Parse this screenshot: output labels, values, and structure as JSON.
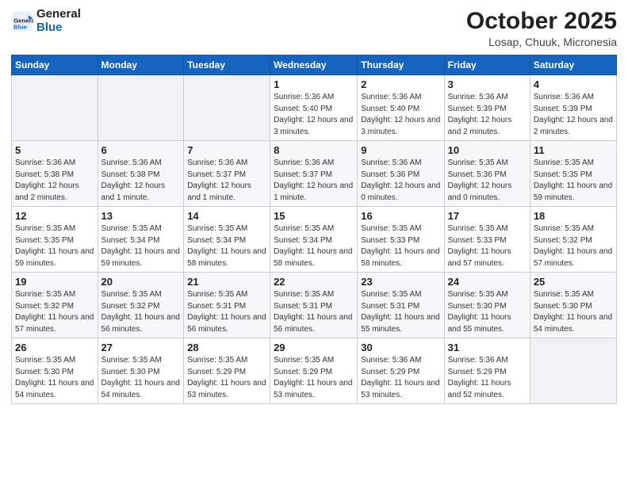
{
  "header": {
    "logo_line1": "General",
    "logo_line2": "Blue",
    "month": "October 2025",
    "location": "Losap, Chuuk, Micronesia"
  },
  "weekdays": [
    "Sunday",
    "Monday",
    "Tuesday",
    "Wednesday",
    "Thursday",
    "Friday",
    "Saturday"
  ],
  "weeks": [
    [
      {
        "day": "",
        "info": ""
      },
      {
        "day": "",
        "info": ""
      },
      {
        "day": "",
        "info": ""
      },
      {
        "day": "1",
        "info": "Sunrise: 5:36 AM\nSunset: 5:40 PM\nDaylight: 12 hours\nand 3 minutes."
      },
      {
        "day": "2",
        "info": "Sunrise: 5:36 AM\nSunset: 5:40 PM\nDaylight: 12 hours\nand 3 minutes."
      },
      {
        "day": "3",
        "info": "Sunrise: 5:36 AM\nSunset: 5:39 PM\nDaylight: 12 hours\nand 2 minutes."
      },
      {
        "day": "4",
        "info": "Sunrise: 5:36 AM\nSunset: 5:39 PM\nDaylight: 12 hours\nand 2 minutes."
      }
    ],
    [
      {
        "day": "5",
        "info": "Sunrise: 5:36 AM\nSunset: 5:38 PM\nDaylight: 12 hours\nand 2 minutes."
      },
      {
        "day": "6",
        "info": "Sunrise: 5:36 AM\nSunset: 5:38 PM\nDaylight: 12 hours\nand 1 minute."
      },
      {
        "day": "7",
        "info": "Sunrise: 5:36 AM\nSunset: 5:37 PM\nDaylight: 12 hours\nand 1 minute."
      },
      {
        "day": "8",
        "info": "Sunrise: 5:36 AM\nSunset: 5:37 PM\nDaylight: 12 hours\nand 1 minute."
      },
      {
        "day": "9",
        "info": "Sunrise: 5:36 AM\nSunset: 5:36 PM\nDaylight: 12 hours\nand 0 minutes."
      },
      {
        "day": "10",
        "info": "Sunrise: 5:35 AM\nSunset: 5:36 PM\nDaylight: 12 hours\nand 0 minutes."
      },
      {
        "day": "11",
        "info": "Sunrise: 5:35 AM\nSunset: 5:35 PM\nDaylight: 11 hours\nand 59 minutes."
      }
    ],
    [
      {
        "day": "12",
        "info": "Sunrise: 5:35 AM\nSunset: 5:35 PM\nDaylight: 11 hours\nand 59 minutes."
      },
      {
        "day": "13",
        "info": "Sunrise: 5:35 AM\nSunset: 5:34 PM\nDaylight: 11 hours\nand 59 minutes."
      },
      {
        "day": "14",
        "info": "Sunrise: 5:35 AM\nSunset: 5:34 PM\nDaylight: 11 hours\nand 58 minutes."
      },
      {
        "day": "15",
        "info": "Sunrise: 5:35 AM\nSunset: 5:34 PM\nDaylight: 11 hours\nand 58 minutes."
      },
      {
        "day": "16",
        "info": "Sunrise: 5:35 AM\nSunset: 5:33 PM\nDaylight: 11 hours\nand 58 minutes."
      },
      {
        "day": "17",
        "info": "Sunrise: 5:35 AM\nSunset: 5:33 PM\nDaylight: 11 hours\nand 57 minutes."
      },
      {
        "day": "18",
        "info": "Sunrise: 5:35 AM\nSunset: 5:32 PM\nDaylight: 11 hours\nand 57 minutes."
      }
    ],
    [
      {
        "day": "19",
        "info": "Sunrise: 5:35 AM\nSunset: 5:32 PM\nDaylight: 11 hours\nand 57 minutes."
      },
      {
        "day": "20",
        "info": "Sunrise: 5:35 AM\nSunset: 5:32 PM\nDaylight: 11 hours\nand 56 minutes."
      },
      {
        "day": "21",
        "info": "Sunrise: 5:35 AM\nSunset: 5:31 PM\nDaylight: 11 hours\nand 56 minutes."
      },
      {
        "day": "22",
        "info": "Sunrise: 5:35 AM\nSunset: 5:31 PM\nDaylight: 11 hours\nand 56 minutes."
      },
      {
        "day": "23",
        "info": "Sunrise: 5:35 AM\nSunset: 5:31 PM\nDaylight: 11 hours\nand 55 minutes."
      },
      {
        "day": "24",
        "info": "Sunrise: 5:35 AM\nSunset: 5:30 PM\nDaylight: 11 hours\nand 55 minutes."
      },
      {
        "day": "25",
        "info": "Sunrise: 5:35 AM\nSunset: 5:30 PM\nDaylight: 11 hours\nand 54 minutes."
      }
    ],
    [
      {
        "day": "26",
        "info": "Sunrise: 5:35 AM\nSunset: 5:30 PM\nDaylight: 11 hours\nand 54 minutes."
      },
      {
        "day": "27",
        "info": "Sunrise: 5:35 AM\nSunset: 5:30 PM\nDaylight: 11 hours\nand 54 minutes."
      },
      {
        "day": "28",
        "info": "Sunrise: 5:35 AM\nSunset: 5:29 PM\nDaylight: 11 hours\nand 53 minutes."
      },
      {
        "day": "29",
        "info": "Sunrise: 5:35 AM\nSunset: 5:29 PM\nDaylight: 11 hours\nand 53 minutes."
      },
      {
        "day": "30",
        "info": "Sunrise: 5:36 AM\nSunset: 5:29 PM\nDaylight: 11 hours\nand 53 minutes."
      },
      {
        "day": "31",
        "info": "Sunrise: 5:36 AM\nSunset: 5:29 PM\nDaylight: 11 hours\nand 52 minutes."
      },
      {
        "day": "",
        "info": ""
      }
    ]
  ]
}
